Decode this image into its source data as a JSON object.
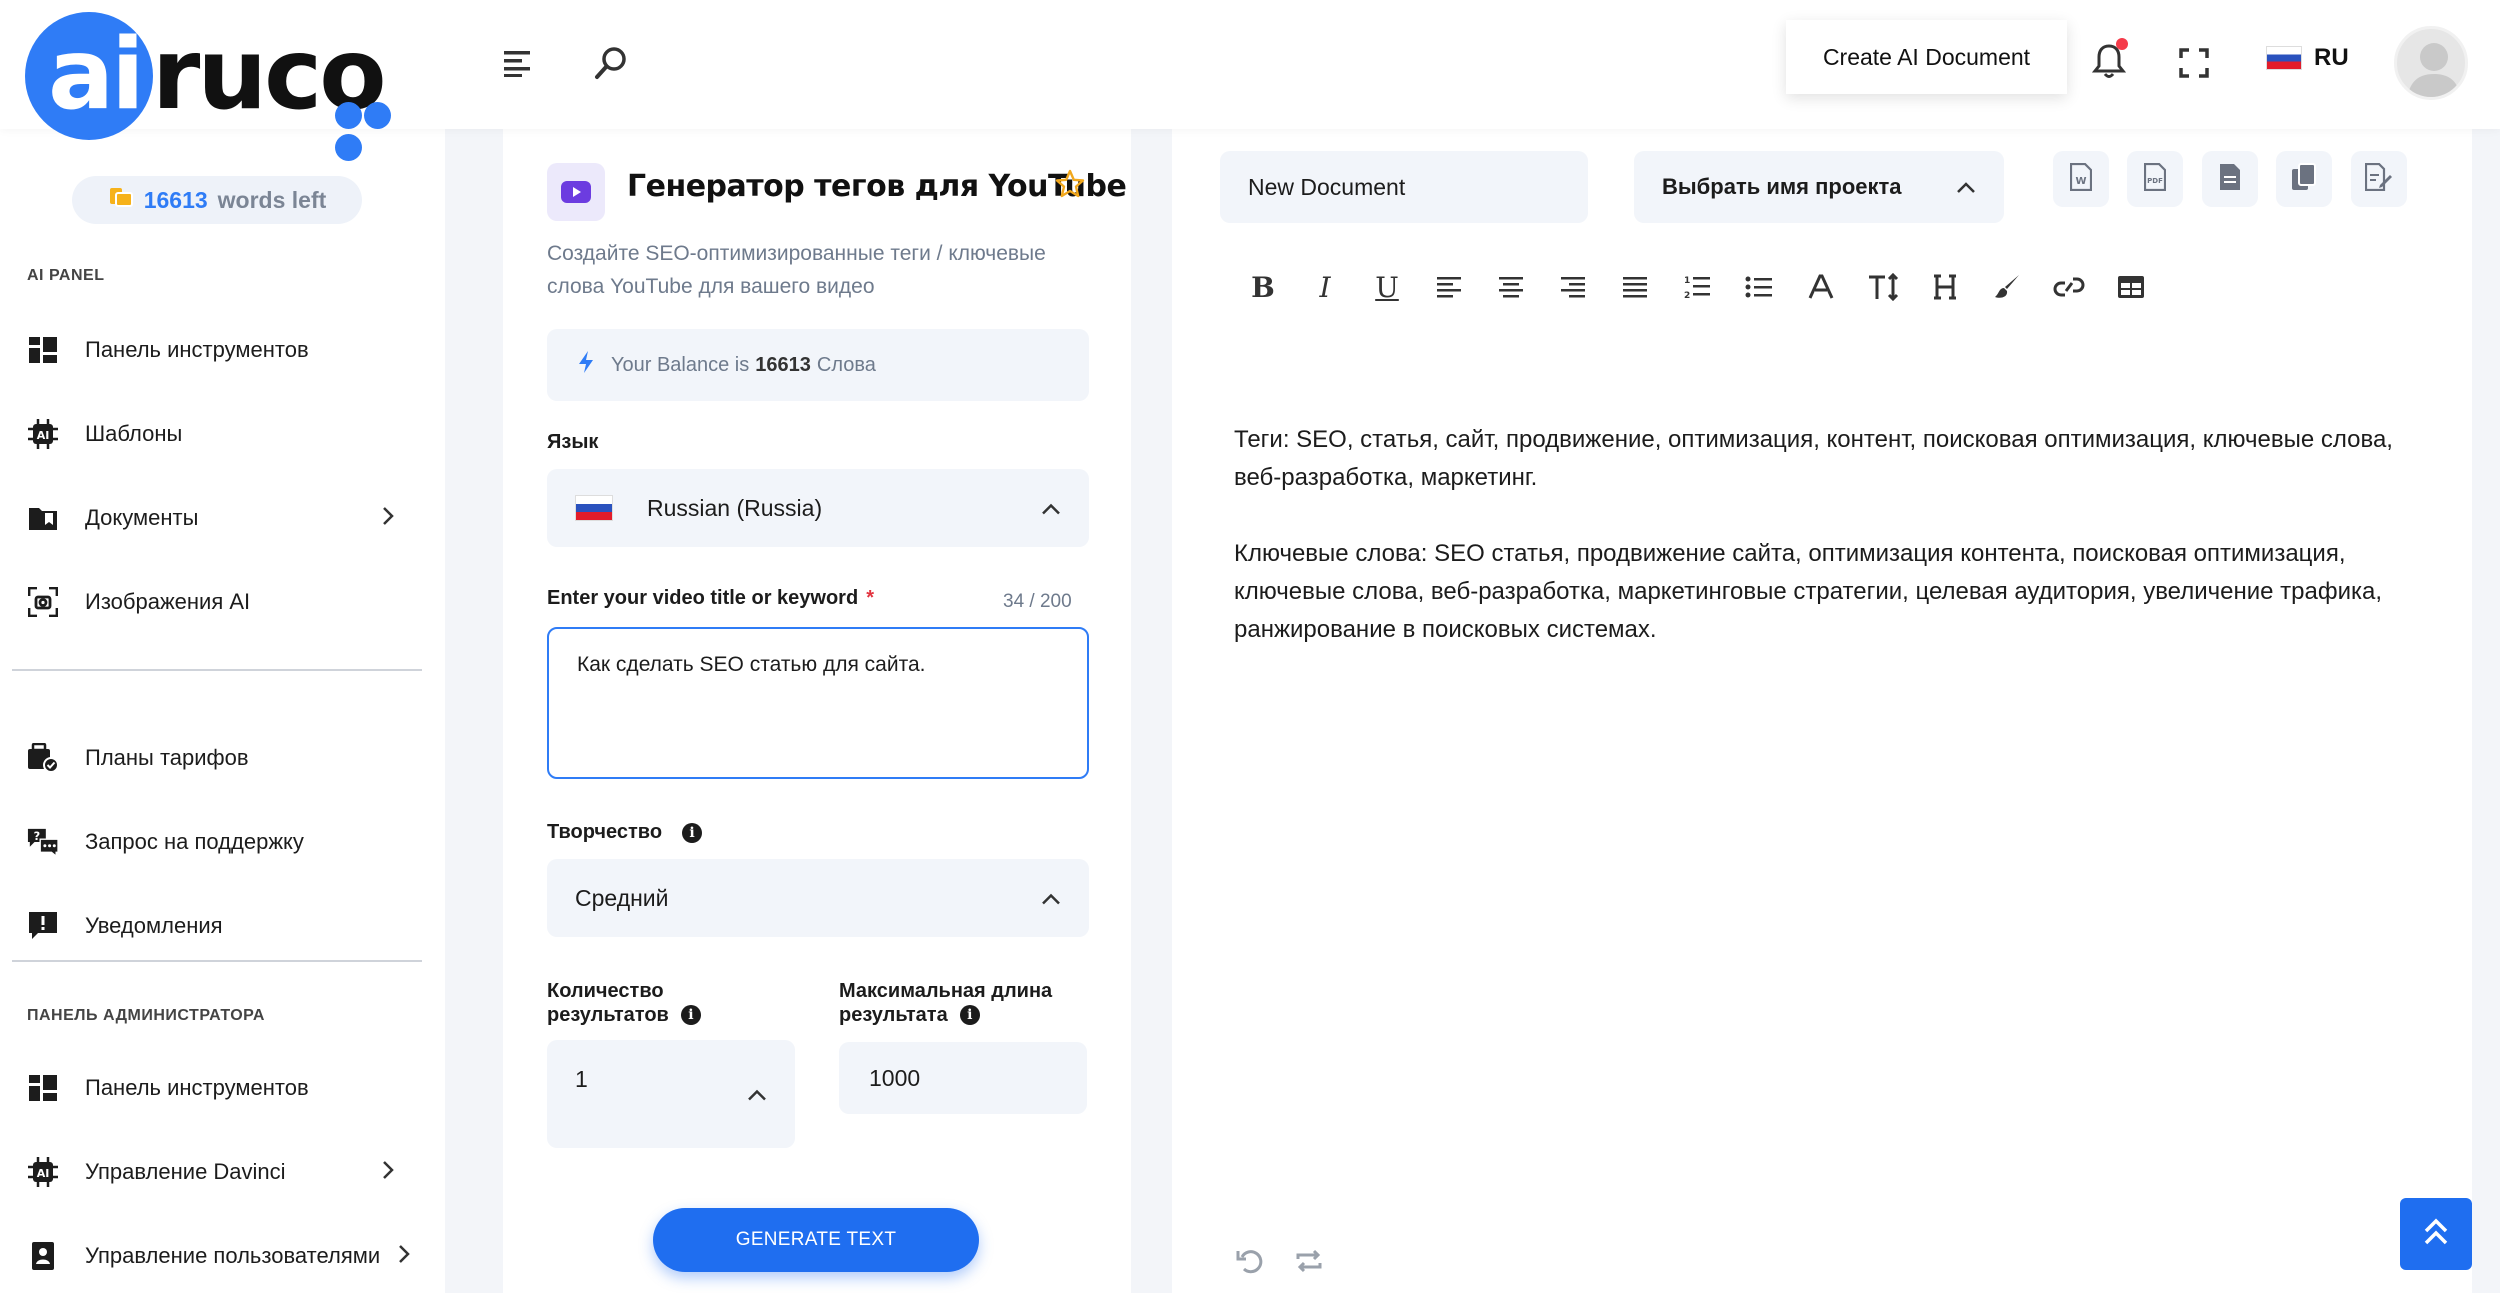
{
  "brand": {
    "logo_ai": "ai",
    "logo_rest": "ruco",
    "accent": "#2f7cf6"
  },
  "header": {
    "create_doc_label": "Create AI Document",
    "lang_code": "RU"
  },
  "sidebar": {
    "words_count": "16613",
    "words_label": "words left",
    "section_ai": "AI PANEL",
    "items_ai": [
      {
        "label": "Панель инструментов",
        "icon": "dashboard-icon"
      },
      {
        "label": "Шаблоны",
        "icon": "ai-chip-icon"
      },
      {
        "label": "Документы",
        "icon": "folder-icon"
      },
      {
        "label": "Изображения AI",
        "icon": "image-scan-icon"
      }
    ],
    "items_account": [
      {
        "label": "Планы тарифов",
        "icon": "plans-icon"
      },
      {
        "label": "Запрос на поддержку",
        "icon": "support-icon"
      },
      {
        "label": "Уведомления",
        "icon": "alert-icon"
      }
    ],
    "section_admin": "ПАНЕЛЬ АДМИНИСТРАТОРА",
    "items_admin": [
      {
        "label": "Панель инструментов",
        "icon": "dashboard-icon"
      },
      {
        "label": "Управление Davinci",
        "icon": "ai-chip-icon"
      },
      {
        "label": "Управление пользователями",
        "icon": "users-icon"
      }
    ]
  },
  "form": {
    "title": "Генератор тегов для YouTube",
    "description": "Создайте SEO-оптимизированные теги / ключевые слова YouTube для вашего видео",
    "balance_prefix": "Your Balance is",
    "balance_value": "16613",
    "balance_suffix": "Слова",
    "language_label": "Язык",
    "language_value": "Russian (Russia)",
    "keyword_label": "Enter your video title or keyword",
    "required_mark": "*",
    "keyword_counter": "34 / 200",
    "keyword_value": "Как сделать SEO статью для сайта. ",
    "creativity_label": "Творчество",
    "creativity_value": "Средний",
    "results_label_1": "Количество",
    "results_label_2": "результатов",
    "results_value": "1",
    "maxlen_label_1": "Максимальная длина",
    "maxlen_label_2": "результата",
    "maxlen_value": "1000",
    "generate_label": "GENERATE TEXT"
  },
  "editor": {
    "doc_name": "New Document",
    "project_label": "Выбрать имя проекта",
    "paragraphs": [
      "Теги: SEO, статья, сайт, продвижение, оптимизация, контент, поисковая оптимизация, ключевые слова, веб-разработка, маркетинг.",
      "Ключевые слова: SEO статья, продвижение сайта, оптимизация контента, поисковая оптимизация, ключевые слова, веб-разработка, маркетинговые стратегии, целевая аудитория, увеличение трафика, ранжирование в поисковых системах."
    ]
  }
}
